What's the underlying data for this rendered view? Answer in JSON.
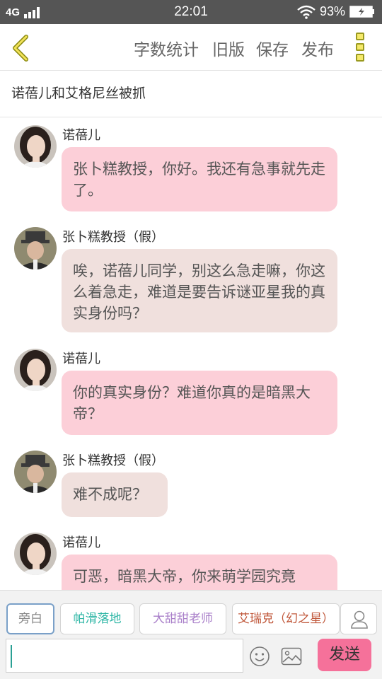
{
  "status_bar": {
    "network": "4G",
    "time": "22:01",
    "battery": "93%"
  },
  "toolbar": {
    "word_count_label": "字数统计",
    "old_version_label": "旧版",
    "save_label": "保存",
    "publish_label": "发布"
  },
  "story": {
    "title": "诺蓓儿和艾格尼丝被抓"
  },
  "messages": [
    {
      "sender": "诺蓓儿",
      "text": "张卜糕教授，你好。我还有急事就先走了。",
      "bubble_color": "#fccfd8"
    },
    {
      "sender": "张卜糕教授（假）",
      "text": "唉，诺蓓儿同学，别这么急走嘛，你这么着急走，难道是要告诉谜亚星我的真实身份吗？",
      "bubble_color": "#f0e0dd"
    },
    {
      "sender": "诺蓓儿",
      "text": "你的真实身份？难道你真的是暗黑大帝？",
      "bubble_color": "#fccfd8"
    },
    {
      "sender": "张卜糕教授（假）",
      "text": "难不成呢？",
      "bubble_color": "#f0e0dd"
    },
    {
      "sender": "诺蓓儿",
      "text": "可恶，暗黑大帝，你来萌学园究竟",
      "bubble_color": "#fccfd8"
    }
  ],
  "roles": [
    {
      "label": "旁白",
      "color": "#888888",
      "selected": true
    },
    {
      "label": "帕滑落地",
      "color": "#2bb5a4",
      "selected": false
    },
    {
      "label": "大甜甜老师",
      "color": "#a97fc9",
      "selected": false
    },
    {
      "label": "艾瑞克（幻之星）",
      "color": "#c0573a",
      "selected": false
    }
  ],
  "composer": {
    "input_value": "",
    "send_label": "发送"
  },
  "icons": {
    "back": "chevron-left-icon",
    "more": "more-vertical-icon",
    "add_role": "person-icon",
    "emoji": "smiley-icon",
    "image": "image-icon"
  }
}
